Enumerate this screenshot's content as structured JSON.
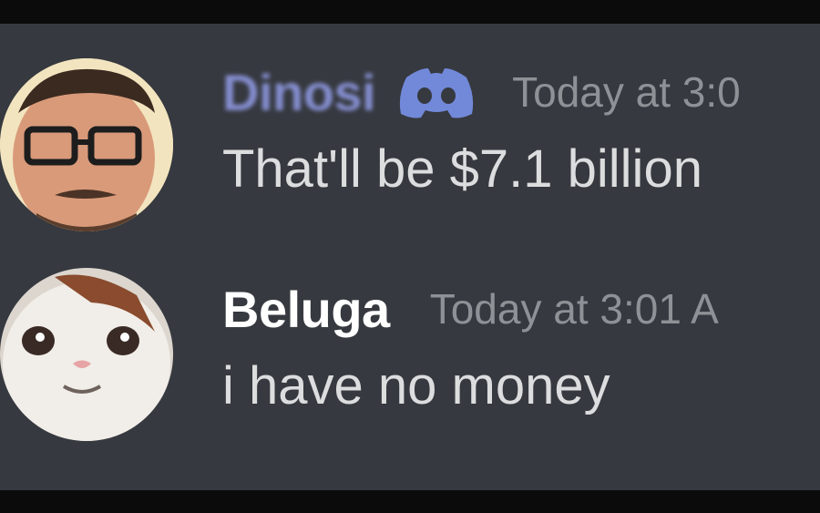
{
  "messages": [
    {
      "author": "Dinosi",
      "author_blurred": true,
      "badge_icon": "discord-logo-icon",
      "timestamp": "Today at 3:0",
      "text": "That'll be $7.1 billion",
      "avatar_icon": "man-with-glasses-avatar"
    },
    {
      "author": "Beluga",
      "author_blurred": false,
      "timestamp": "Today at 3:01 A",
      "text": "i have no money",
      "avatar_icon": "beluga-cat-avatar"
    }
  ],
  "colors": {
    "background": "#36393f",
    "username": "#ffffff",
    "message_text": "#dcddde",
    "timestamp": "#8e9297",
    "blurple": "#7289da"
  }
}
